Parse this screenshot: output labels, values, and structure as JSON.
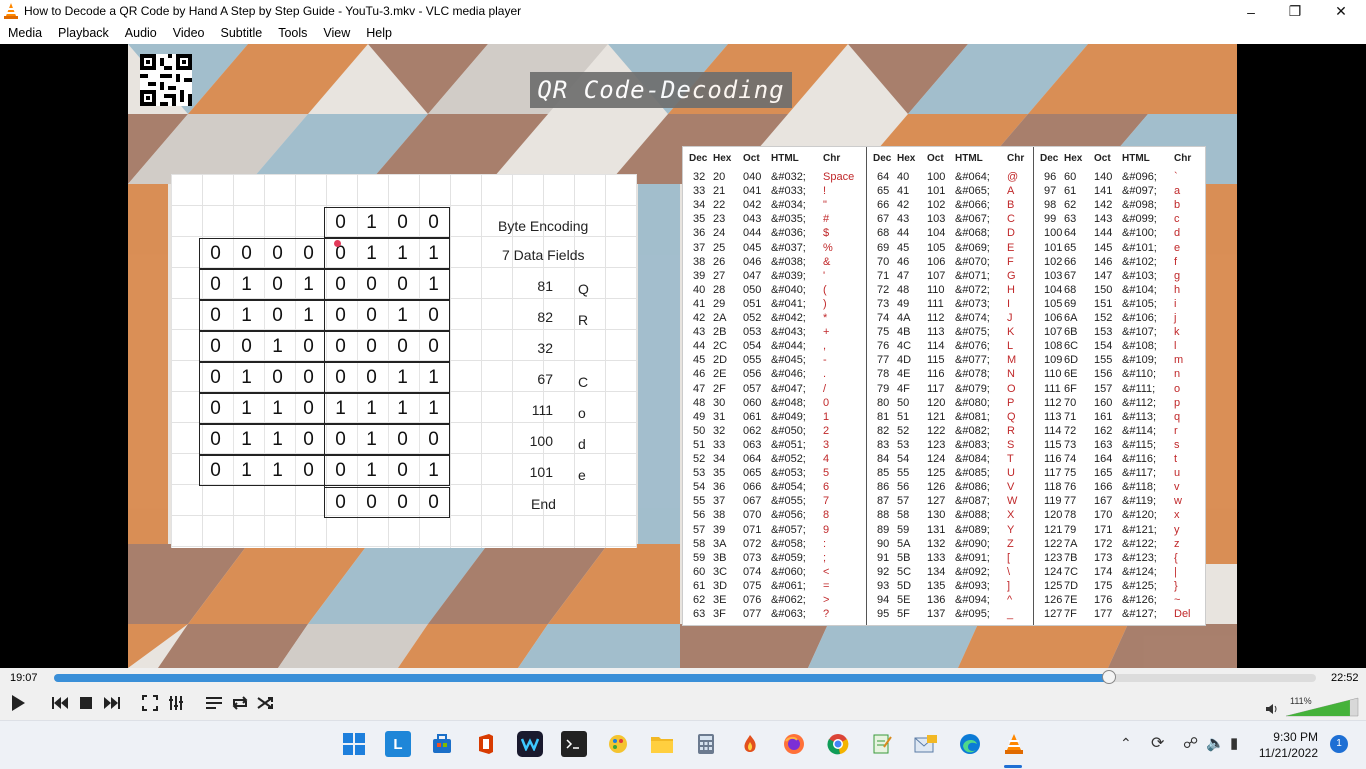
{
  "window": {
    "title": "How to Decode a QR Code by Hand A Step by Step Guide - YouTu-3.mkv - VLC media player"
  },
  "menu": [
    "Media",
    "Playback",
    "Audio",
    "Video",
    "Subtitle",
    "Tools",
    "View",
    "Help"
  ],
  "slide": {
    "title": "QR Code-Decoding",
    "bits_top": [
      "0",
      "1",
      "0",
      "0"
    ],
    "bit_rows": [
      [
        "0",
        "0",
        "0",
        "0",
        "0",
        "1",
        "1",
        "1"
      ],
      [
        "0",
        "1",
        "0",
        "1",
        "0",
        "0",
        "0",
        "1"
      ],
      [
        "0",
        "1",
        "0",
        "1",
        "0",
        "0",
        "1",
        "0"
      ],
      [
        "0",
        "0",
        "1",
        "0",
        "0",
        "0",
        "0",
        "0"
      ],
      [
        "0",
        "1",
        "0",
        "0",
        "0",
        "0",
        "1",
        "1"
      ],
      [
        "0",
        "1",
        "1",
        "0",
        "1",
        "1",
        "1",
        "1"
      ],
      [
        "0",
        "1",
        "1",
        "0",
        "0",
        "1",
        "0",
        "0"
      ],
      [
        "0",
        "1",
        "1",
        "0",
        "0",
        "1",
        "0",
        "1"
      ]
    ],
    "bits_bottom": [
      "0",
      "0",
      "0",
      "0"
    ],
    "label_encoding": "Byte Encoding",
    "label_fields": "7 Data Fields",
    "decoded": [
      {
        "value": "81",
        "char": "Q"
      },
      {
        "value": "82",
        "char": "R"
      },
      {
        "value": "32",
        "char": ""
      },
      {
        "value": "67",
        "char": "C"
      },
      {
        "value": "111",
        "char": "o"
      },
      {
        "value": "100",
        "char": "d"
      },
      {
        "value": "101",
        "char": "e"
      }
    ],
    "label_end": "End"
  },
  "ascii_table": {
    "headers": [
      "Dec",
      "Hex",
      "Oct",
      "HTML",
      "Chr"
    ],
    "col1": [
      [
        "32",
        "20",
        "040",
        "&#032;",
        "Space"
      ],
      [
        "33",
        "21",
        "041",
        "&#033;",
        "!"
      ],
      [
        "34",
        "22",
        "042",
        "&#034;",
        "\""
      ],
      [
        "35",
        "23",
        "043",
        "&#035;",
        "#"
      ],
      [
        "36",
        "24",
        "044",
        "&#036;",
        "$"
      ],
      [
        "37",
        "25",
        "045",
        "&#037;",
        "%"
      ],
      [
        "38",
        "26",
        "046",
        "&#038;",
        "&"
      ],
      [
        "39",
        "27",
        "047",
        "&#039;",
        "'"
      ],
      [
        "40",
        "28",
        "050",
        "&#040;",
        "("
      ],
      [
        "41",
        "29",
        "051",
        "&#041;",
        ")"
      ],
      [
        "42",
        "2A",
        "052",
        "&#042;",
        "*"
      ],
      [
        "43",
        "2B",
        "053",
        "&#043;",
        "+"
      ],
      [
        "44",
        "2C",
        "054",
        "&#044;",
        ","
      ],
      [
        "45",
        "2D",
        "055",
        "&#045;",
        "-"
      ],
      [
        "46",
        "2E",
        "056",
        "&#046;",
        "."
      ],
      [
        "47",
        "2F",
        "057",
        "&#047;",
        "/"
      ],
      [
        "48",
        "30",
        "060",
        "&#048;",
        "0"
      ],
      [
        "49",
        "31",
        "061",
        "&#049;",
        "1"
      ],
      [
        "50",
        "32",
        "062",
        "&#050;",
        "2"
      ],
      [
        "51",
        "33",
        "063",
        "&#051;",
        "3"
      ],
      [
        "52",
        "34",
        "064",
        "&#052;",
        "4"
      ],
      [
        "53",
        "35",
        "065",
        "&#053;",
        "5"
      ],
      [
        "54",
        "36",
        "066",
        "&#054;",
        "6"
      ],
      [
        "55",
        "37",
        "067",
        "&#055;",
        "7"
      ],
      [
        "56",
        "38",
        "070",
        "&#056;",
        "8"
      ],
      [
        "57",
        "39",
        "071",
        "&#057;",
        "9"
      ],
      [
        "58",
        "3A",
        "072",
        "&#058;",
        ":"
      ],
      [
        "59",
        "3B",
        "073",
        "&#059;",
        ";"
      ],
      [
        "60",
        "3C",
        "074",
        "&#060;",
        "<"
      ],
      [
        "61",
        "3D",
        "075",
        "&#061;",
        "="
      ],
      [
        "62",
        "3E",
        "076",
        "&#062;",
        ">"
      ],
      [
        "63",
        "3F",
        "077",
        "&#063;",
        "?"
      ]
    ],
    "col2": [
      [
        "64",
        "40",
        "100",
        "&#064;",
        "@"
      ],
      [
        "65",
        "41",
        "101",
        "&#065;",
        "A"
      ],
      [
        "66",
        "42",
        "102",
        "&#066;",
        "B"
      ],
      [
        "67",
        "43",
        "103",
        "&#067;",
        "C"
      ],
      [
        "68",
        "44",
        "104",
        "&#068;",
        "D"
      ],
      [
        "69",
        "45",
        "105",
        "&#069;",
        "E"
      ],
      [
        "70",
        "46",
        "106",
        "&#070;",
        "F"
      ],
      [
        "71",
        "47",
        "107",
        "&#071;",
        "G"
      ],
      [
        "72",
        "48",
        "110",
        "&#072;",
        "H"
      ],
      [
        "73",
        "49",
        "111",
        "&#073;",
        "I"
      ],
      [
        "74",
        "4A",
        "112",
        "&#074;",
        "J"
      ],
      [
        "75",
        "4B",
        "113",
        "&#075;",
        "K"
      ],
      [
        "76",
        "4C",
        "114",
        "&#076;",
        "L"
      ],
      [
        "77",
        "4D",
        "115",
        "&#077;",
        "M"
      ],
      [
        "78",
        "4E",
        "116",
        "&#078;",
        "N"
      ],
      [
        "79",
        "4F",
        "117",
        "&#079;",
        "O"
      ],
      [
        "80",
        "50",
        "120",
        "&#080;",
        "P"
      ],
      [
        "81",
        "51",
        "121",
        "&#081;",
        "Q"
      ],
      [
        "82",
        "52",
        "122",
        "&#082;",
        "R"
      ],
      [
        "83",
        "53",
        "123",
        "&#083;",
        "S"
      ],
      [
        "84",
        "54",
        "124",
        "&#084;",
        "T"
      ],
      [
        "85",
        "55",
        "125",
        "&#085;",
        "U"
      ],
      [
        "86",
        "56",
        "126",
        "&#086;",
        "V"
      ],
      [
        "87",
        "57",
        "127",
        "&#087;",
        "W"
      ],
      [
        "88",
        "58",
        "130",
        "&#088;",
        "X"
      ],
      [
        "89",
        "59",
        "131",
        "&#089;",
        "Y"
      ],
      [
        "90",
        "5A",
        "132",
        "&#090;",
        "Z"
      ],
      [
        "91",
        "5B",
        "133",
        "&#091;",
        "["
      ],
      [
        "92",
        "5C",
        "134",
        "&#092;",
        "\\"
      ],
      [
        "93",
        "5D",
        "135",
        "&#093;",
        "]"
      ],
      [
        "94",
        "5E",
        "136",
        "&#094;",
        "^"
      ],
      [
        "95",
        "5F",
        "137",
        "&#095;",
        "_"
      ]
    ],
    "col3": [
      [
        "96",
        "60",
        "140",
        "&#096;",
        "`"
      ],
      [
        "97",
        "61",
        "141",
        "&#097;",
        "a"
      ],
      [
        "98",
        "62",
        "142",
        "&#098;",
        "b"
      ],
      [
        "99",
        "63",
        "143",
        "&#099;",
        "c"
      ],
      [
        "100",
        "64",
        "144",
        "&#100;",
        "d"
      ],
      [
        "101",
        "65",
        "145",
        "&#101;",
        "e"
      ],
      [
        "102",
        "66",
        "146",
        "&#102;",
        "f"
      ],
      [
        "103",
        "67",
        "147",
        "&#103;",
        "g"
      ],
      [
        "104",
        "68",
        "150",
        "&#104;",
        "h"
      ],
      [
        "105",
        "69",
        "151",
        "&#105;",
        "i"
      ],
      [
        "106",
        "6A",
        "152",
        "&#106;",
        "j"
      ],
      [
        "107",
        "6B",
        "153",
        "&#107;",
        "k"
      ],
      [
        "108",
        "6C",
        "154",
        "&#108;",
        "l"
      ],
      [
        "109",
        "6D",
        "155",
        "&#109;",
        "m"
      ],
      [
        "110",
        "6E",
        "156",
        "&#110;",
        "n"
      ],
      [
        "111",
        "6F",
        "157",
        "&#111;",
        "o"
      ],
      [
        "112",
        "70",
        "160",
        "&#112;",
        "p"
      ],
      [
        "113",
        "71",
        "161",
        "&#113;",
        "q"
      ],
      [
        "114",
        "72",
        "162",
        "&#114;",
        "r"
      ],
      [
        "115",
        "73",
        "163",
        "&#115;",
        "s"
      ],
      [
        "116",
        "74",
        "164",
        "&#116;",
        "t"
      ],
      [
        "117",
        "75",
        "165",
        "&#117;",
        "u"
      ],
      [
        "118",
        "76",
        "166",
        "&#118;",
        "v"
      ],
      [
        "119",
        "77",
        "167",
        "&#119;",
        "w"
      ],
      [
        "120",
        "78",
        "170",
        "&#120;",
        "x"
      ],
      [
        "121",
        "79",
        "171",
        "&#121;",
        "y"
      ],
      [
        "122",
        "7A",
        "172",
        "&#122;",
        "z"
      ],
      [
        "123",
        "7B",
        "173",
        "&#123;",
        "{"
      ],
      [
        "124",
        "7C",
        "174",
        "&#124;",
        "|"
      ],
      [
        "125",
        "7D",
        "175",
        "&#125;",
        "}"
      ],
      [
        "126",
        "7E",
        "176",
        "&#126;",
        "~"
      ],
      [
        "127",
        "7F",
        "177",
        "&#127;",
        "Del"
      ]
    ]
  },
  "player": {
    "elapsed": "19:07",
    "total": "22:52",
    "progress": 0.836,
    "volume_label": "111%",
    "volume": 1.11,
    "accent": "#3a8fd8"
  },
  "taskbar": {
    "icons": [
      "windows-start",
      "launcher-l",
      "store",
      "office",
      "webex",
      "terminal",
      "paint",
      "explorer",
      "calculator",
      "game",
      "firefox",
      "chrome",
      "notepad",
      "mail-photos",
      "edge",
      "vlc"
    ],
    "time": "9:30 PM",
    "date": "11/21/2022",
    "notification_count": "1"
  }
}
